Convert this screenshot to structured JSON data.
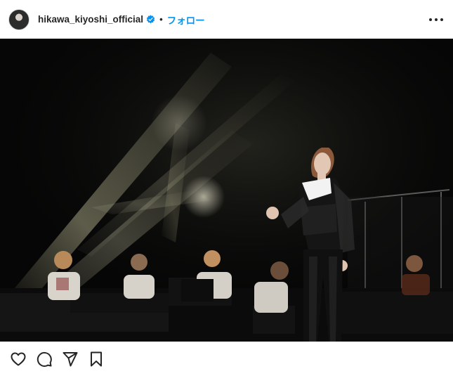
{
  "post": {
    "header": {
      "username": "hikawa_kiyoshi_official",
      "separator": "•",
      "follow_label": "フォロー",
      "verified": true
    },
    "icons": {
      "avatar": "profile-avatar",
      "verified": "verified-badge-icon",
      "more": "more-options-icon",
      "like": "heart-icon",
      "comment": "comment-icon",
      "share": "send-icon",
      "save": "bookmark-icon"
    },
    "colors": {
      "accent": "#0095f6",
      "text": "#262626"
    }
  }
}
